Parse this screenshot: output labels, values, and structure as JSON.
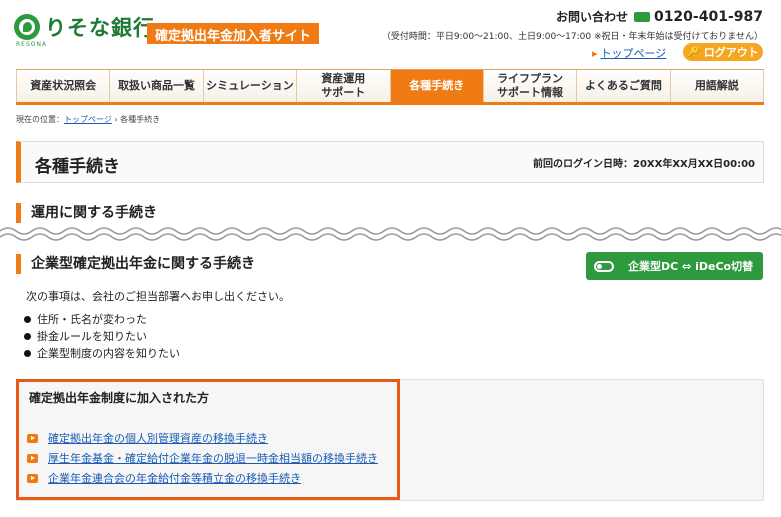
{
  "header": {
    "bank_name": "りそな銀行",
    "bank_sub": "RESONA",
    "site_name": "確定拠出年金加入者サイト",
    "contact_label": "お問い合わせ",
    "contact_number": "0120-401-987",
    "contact_hours": "（受付時間：平日9:00～21:00、土日9:00～17:00 ※祝日・年末年始は受付けておりません）",
    "top_link": "トップページ",
    "logout_label": "ログアウト"
  },
  "nav": {
    "items": [
      {
        "label": "資産状況照会"
      },
      {
        "label": "取扱い商品一覧"
      },
      {
        "label": "シミュレーション"
      },
      {
        "label": "資産運用\nサポート"
      },
      {
        "label": "各種手続き"
      },
      {
        "label": "ライフプラン\nサポート情報"
      },
      {
        "label": "よくあるご質問"
      },
      {
        "label": "用語解説"
      }
    ],
    "active_index": 4
  },
  "breadcrumb": {
    "prefix": "現在の位置：",
    "home": "トップページ",
    "sep": "›",
    "current": "各種手続き"
  },
  "page": {
    "title": "各種手続き",
    "last_login": "前回のログイン日時：20XX年XX月XX日00:00"
  },
  "sections": {
    "operation_title": "運用に関する手続き",
    "corporate_title": "企業型確定拠出年金に関する手続き",
    "switch_button": "企業型DC ⇔ iDeCo切替",
    "intro": "次の事項は、会社のご担当部署へお申し出ください。",
    "bullets": [
      "住所・氏名が変わった",
      "掛金ルールを知りたい",
      "企業型制度の内容を知りたい"
    ]
  },
  "panel": {
    "title": "確定拠出年金制度に加入された方",
    "links": [
      "確定拠出年金の個人別管理資産の移換手続き",
      "厚生年金基金・確定給付企業年金の脱退一時金相当額の移換手続き",
      "企業年金連合会の年金給付金等積立金の移換手続き"
    ]
  },
  "colors": {
    "accent": "#f07b14",
    "brand_green": "#2d9a3e",
    "panel_border": "#e85a1a",
    "link": "#1a5cb5"
  }
}
